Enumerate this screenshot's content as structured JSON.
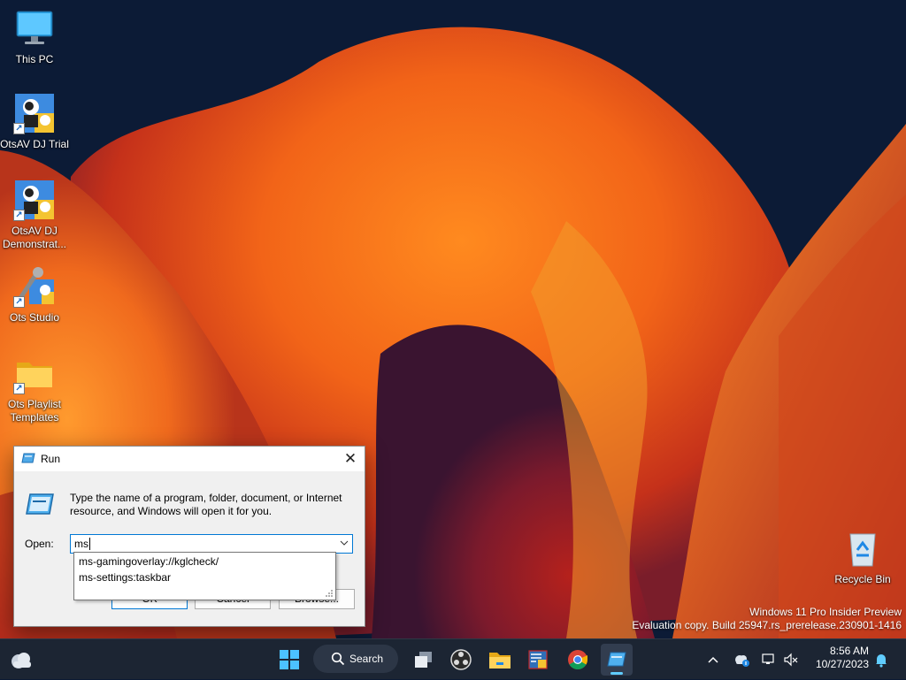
{
  "desktop": {
    "icons": [
      {
        "label": "This PC",
        "icon": "monitor-icon"
      },
      {
        "label": "OtsAV DJ Trial",
        "icon": "otsav-dj-icon"
      },
      {
        "label": "OtsAV DJ Demonstrat...",
        "icon": "otsav-dj-demo-icon"
      },
      {
        "label": "Ots Studio",
        "icon": "ots-studio-icon"
      },
      {
        "label": "Ots Playlist Templates",
        "icon": "folder-icon"
      },
      {
        "label": "Recycle Bin",
        "icon": "recycle-bin-icon"
      }
    ],
    "watermark": {
      "line1": "Windows 11 Pro Insider Preview",
      "line2": "Evaluation copy. Build 25947.rs_prerelease.230901-1416"
    }
  },
  "run_dialog": {
    "title": "Run",
    "close_glyph": "✕",
    "description": "Type the name of a program, folder, document, or Internet resource, and Windows will open it for you.",
    "open_label": "Open:",
    "input_value": "ms",
    "autocomplete": [
      "ms-gamingoverlay://kglcheck/",
      "ms-settings:taskbar"
    ],
    "buttons": {
      "ok": "OK",
      "cancel": "Cancel",
      "browse": "Browse..."
    }
  },
  "taskbar": {
    "search_label": "Search",
    "clock_time": "8:56 AM",
    "clock_date": "10/27/2023",
    "accent_color": "#60cdff"
  }
}
